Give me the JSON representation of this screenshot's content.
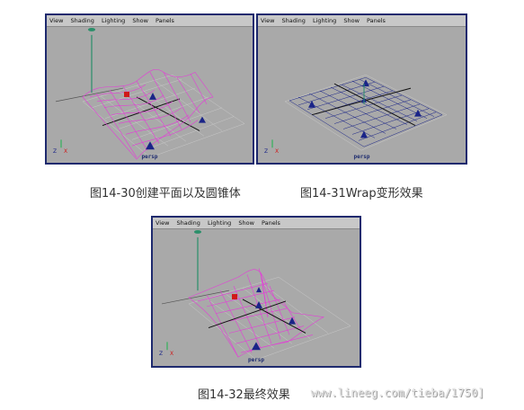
{
  "viewport_menu": [
    "View",
    "Shading",
    "Lighting",
    "Show",
    "Panels"
  ],
  "camera_label": "persp",
  "captions": {
    "fig30": "图14-30创建平面以及圆锥体",
    "fig31": "图14-31Wrap变形效果",
    "fig32": "图14-32最终效果"
  },
  "watermark": "www.lineeg.com/tieba/1750]",
  "colors": {
    "viewport_bg": "#a9a9a9",
    "frame": "#1e2a6e",
    "surface": "#e43cd8",
    "mesh_blue": "#1a2488",
    "grid": "#c8c8c8"
  }
}
